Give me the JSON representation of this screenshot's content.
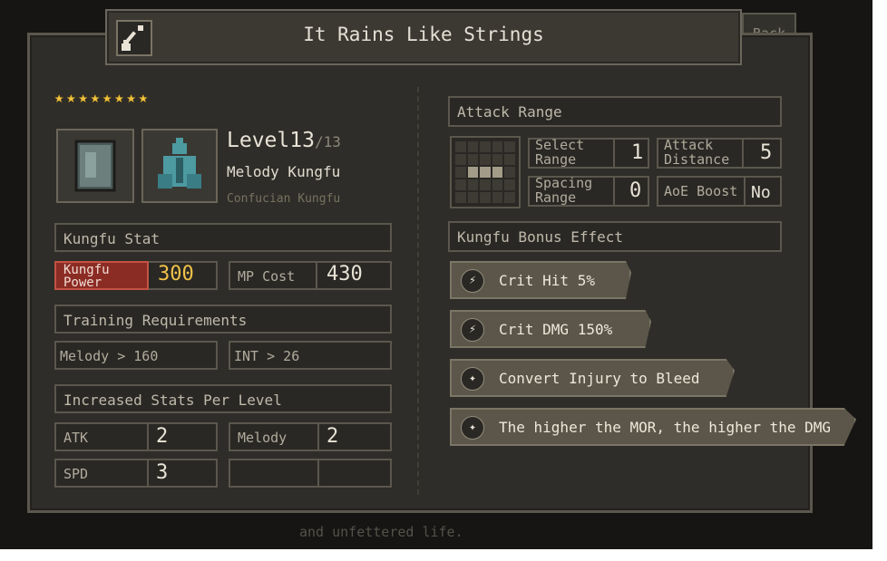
{
  "title": "It Rains Like Strings",
  "back_label": "Back",
  "bottom_text": "and unfettered life.",
  "stars_count": 8,
  "level": {
    "label": "Level",
    "current": "13",
    "max": "/13"
  },
  "kungfu": {
    "name": "Melody Kungfu",
    "school": "Confucian Kungfu"
  },
  "kungfu_stat": {
    "header": "Kungfu Stat",
    "power_label": "Kungfu Power",
    "power_value": "300",
    "mp_label": "MP Cost",
    "mp_value": "430"
  },
  "training": {
    "header": "Training Requirements",
    "req1": "Melody > 160",
    "req2": "INT > 26"
  },
  "increased": {
    "header": "Increased Stats Per Level",
    "atk_label": "ATK",
    "atk_value": "2",
    "melody_label": "Melody",
    "melody_value": "2",
    "spd_label": "SPD",
    "spd_value": "3"
  },
  "attack_range": {
    "header": "Attack Range",
    "select_label": "Select Range",
    "select_value": "1",
    "attack_distance_label": "Attack Distance",
    "attack_distance_value": "5",
    "spacing_label": "Spacing Range",
    "spacing_value": "0",
    "aoe_label": "AoE Boost",
    "aoe_value": "No"
  },
  "bonus": {
    "header": "Kungfu Bonus Effect",
    "effects": [
      {
        "text": "Crit Hit 5%",
        "icon": "lightning-icon"
      },
      {
        "text": "Crit DMG 150%",
        "icon": "lightning-icon"
      },
      {
        "text": "Convert Injury to Bleed",
        "icon": "compass-icon"
      },
      {
        "text": "The higher the MOR, the higher the DMG",
        "icon": "compass-icon"
      }
    ]
  },
  "colors": {
    "accent_red": "#8b2c24",
    "highlight_yellow": "#f2c23a",
    "panel": "#2f2d29"
  }
}
